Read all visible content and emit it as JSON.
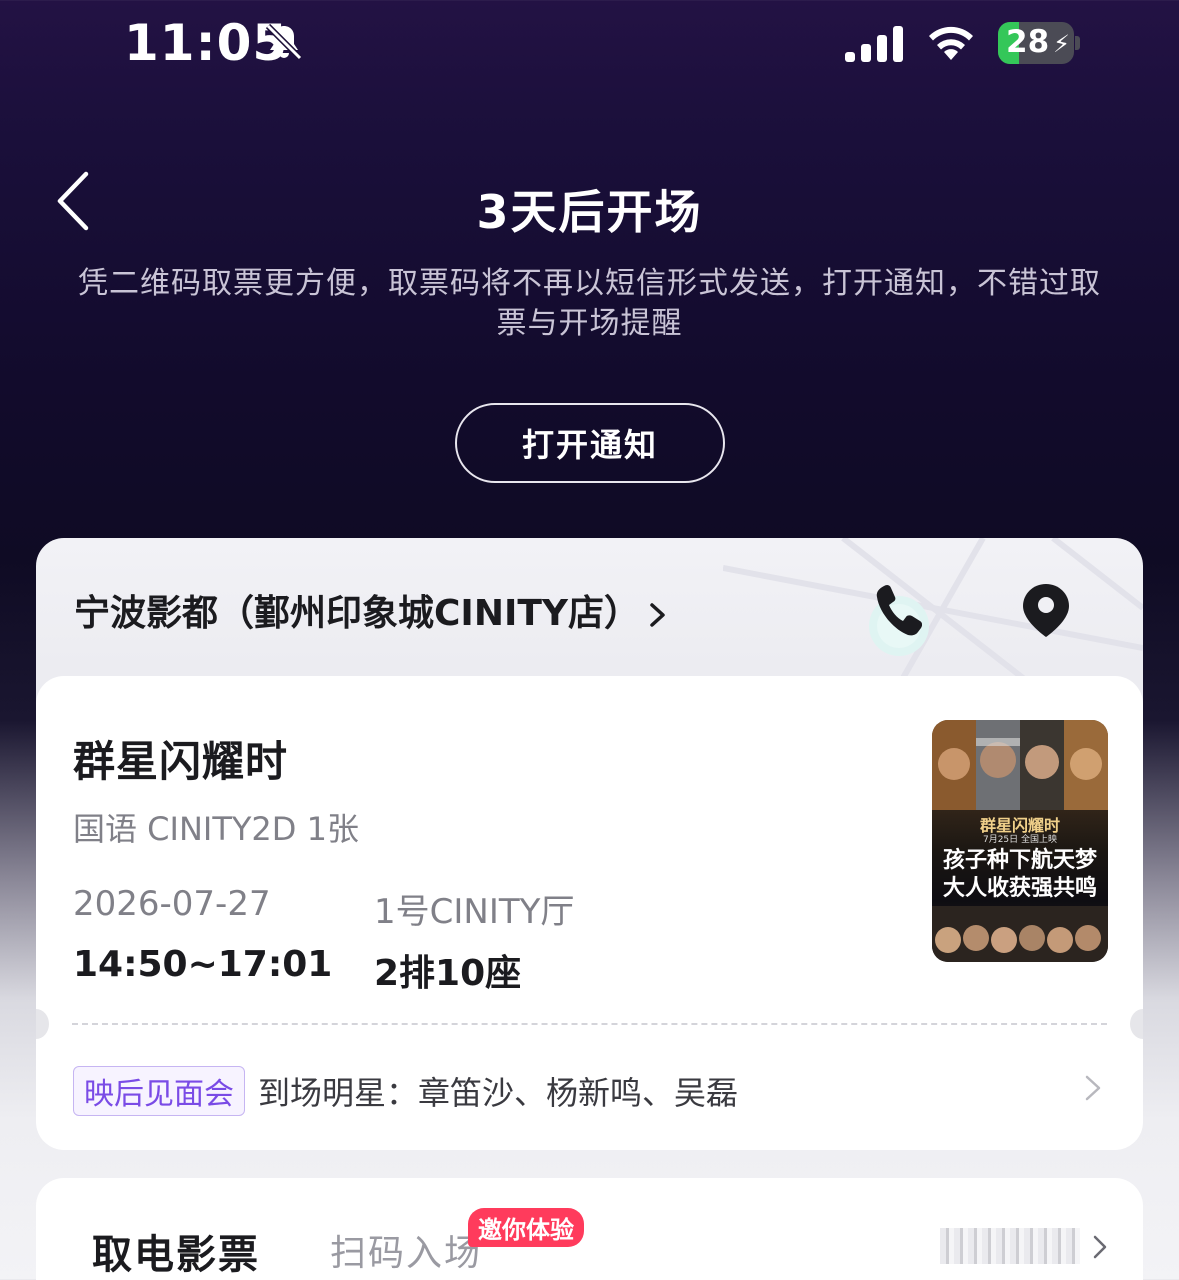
{
  "status_bar": {
    "time": "11:05",
    "battery": "28",
    "battery_level": 0.28
  },
  "header": {
    "title": "3天后开场",
    "subtitle": "凭二维码取票更方便，取票码将不再以短信形式发送，打开通知，不错过取票与开场提醒",
    "notify_button": "打开通知"
  },
  "cinema": {
    "name": "宁波影都（鄞州印象城CINITY店）"
  },
  "ticket": {
    "movie_title": "群星闪耀时",
    "meta": "国语 CINITY2D 1张",
    "date": "2026-07-27",
    "hall": "1号CINITY厅",
    "time": "14:50~17:01",
    "seat": "2排10座",
    "poster": {
      "title": "群星闪耀时",
      "date": "7月25日 全国上映",
      "line1": "孩子种下航天梦",
      "line2": "大人收获强共鸣"
    },
    "event": {
      "tag": "映后见面会",
      "text": "到场明星：章笛沙、杨新鸣、吴磊"
    }
  },
  "bottom": {
    "tab_active": "取电影票",
    "tab_inactive": "扫码入场",
    "badge": "邀你体验"
  },
  "colors": {
    "accent_purple": "#7a4be6",
    "badge_red": "#ff3b5c",
    "battery_green": "#34c759"
  }
}
